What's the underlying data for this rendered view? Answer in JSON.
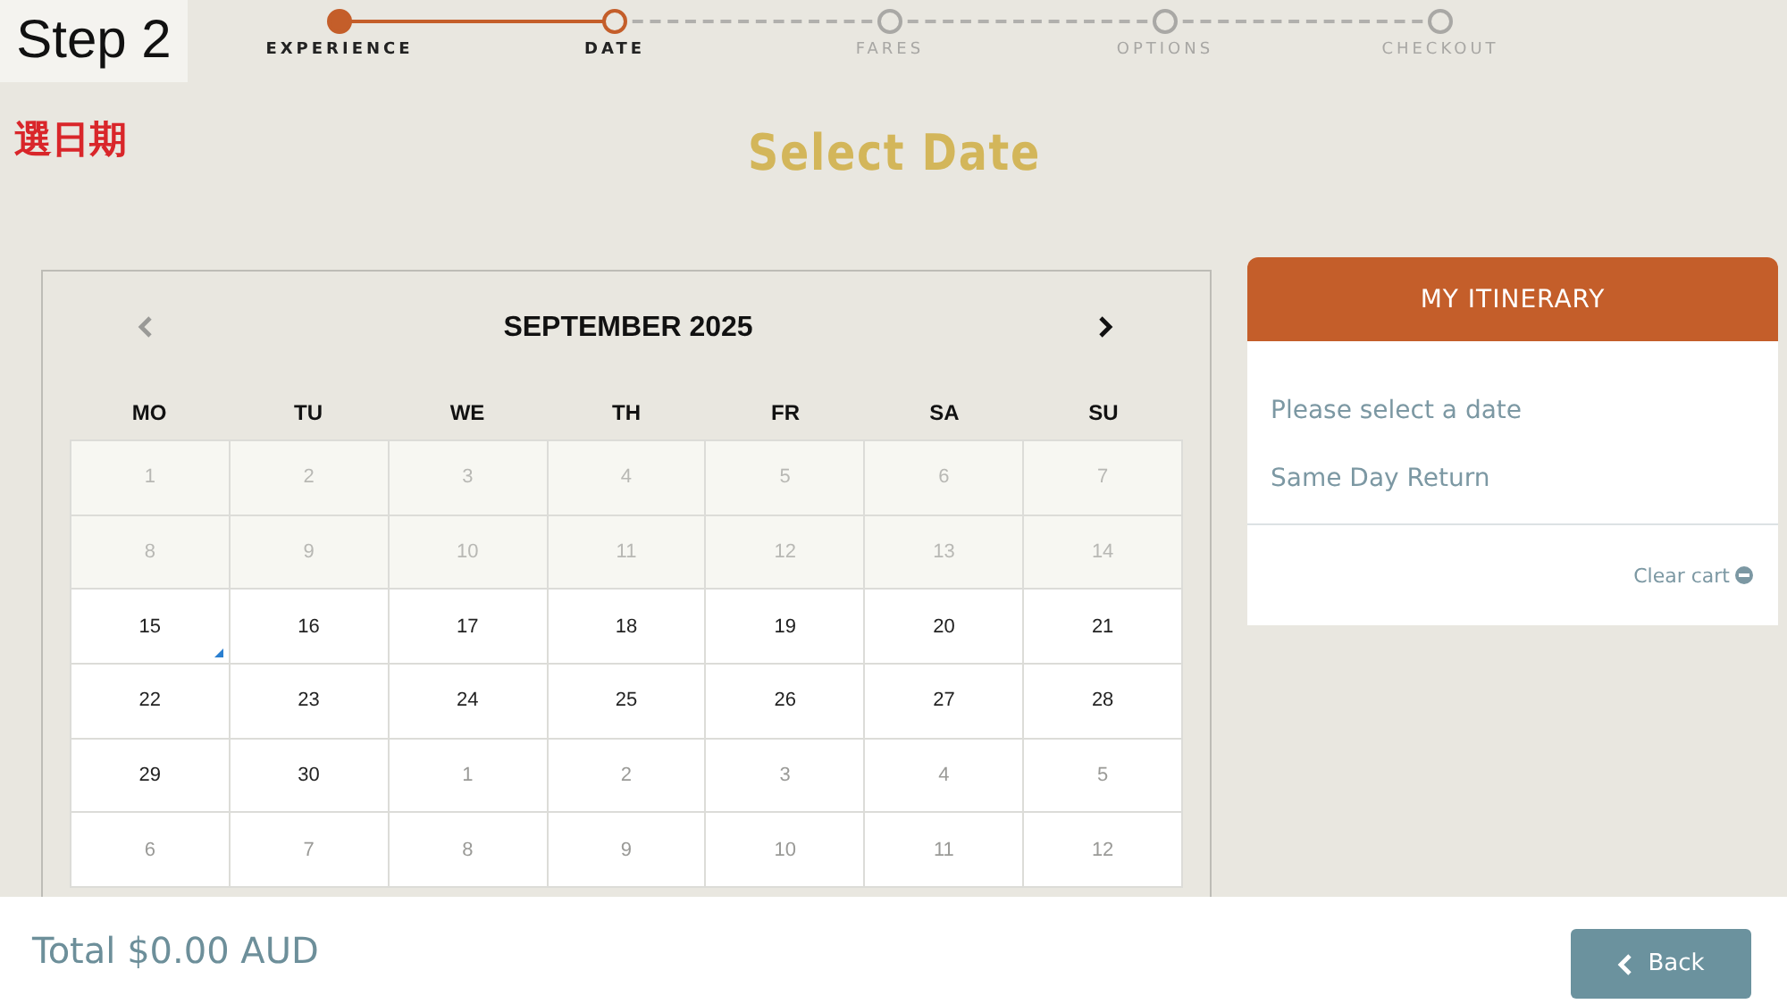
{
  "annotation": {
    "step_label": "Step 2",
    "caption": "選日期"
  },
  "steps": [
    {
      "label": "EXPERIENCE",
      "completed": true,
      "selected": false
    },
    {
      "label": "DATE",
      "completed": false,
      "selected": true
    },
    {
      "label": "FARES",
      "completed": false,
      "selected": false
    },
    {
      "label": "OPTIONS",
      "completed": false,
      "selected": false
    },
    {
      "label": "CHECKOUT",
      "completed": false,
      "selected": false
    }
  ],
  "heading": "Select Date",
  "calendar": {
    "month": "SEPTEMBER 2025",
    "prev": {
      "disabled": true
    },
    "next": {
      "disabled": false
    },
    "weekdays": [
      "MO",
      "TU",
      "WE",
      "TH",
      "FR",
      "SA",
      "SU"
    ],
    "days": [
      {
        "day": "1",
        "kind": "past",
        "today": false
      },
      {
        "day": "2",
        "kind": "past",
        "today": false
      },
      {
        "day": "3",
        "kind": "past",
        "today": false
      },
      {
        "day": "4",
        "kind": "past",
        "today": false
      },
      {
        "day": "5",
        "kind": "past",
        "today": false
      },
      {
        "day": "6",
        "kind": "past",
        "today": false
      },
      {
        "day": "7",
        "kind": "past",
        "today": false
      },
      {
        "day": "8",
        "kind": "past",
        "today": false
      },
      {
        "day": "9",
        "kind": "past",
        "today": false
      },
      {
        "day": "10",
        "kind": "past",
        "today": false
      },
      {
        "day": "11",
        "kind": "past",
        "today": false
      },
      {
        "day": "12",
        "kind": "past",
        "today": false
      },
      {
        "day": "13",
        "kind": "past",
        "today": false
      },
      {
        "day": "14",
        "kind": "past",
        "today": false
      },
      {
        "day": "15",
        "kind": "available",
        "today": true
      },
      {
        "day": "16",
        "kind": "available",
        "today": false
      },
      {
        "day": "17",
        "kind": "available",
        "today": false
      },
      {
        "day": "18",
        "kind": "available",
        "today": false
      },
      {
        "day": "19",
        "kind": "available",
        "today": false
      },
      {
        "day": "20",
        "kind": "available",
        "today": false
      },
      {
        "day": "21",
        "kind": "available",
        "today": false
      },
      {
        "day": "22",
        "kind": "available",
        "today": false
      },
      {
        "day": "23",
        "kind": "available",
        "today": false
      },
      {
        "day": "24",
        "kind": "available",
        "today": false
      },
      {
        "day": "25",
        "kind": "available",
        "today": false
      },
      {
        "day": "26",
        "kind": "available",
        "today": false
      },
      {
        "day": "27",
        "kind": "available",
        "today": false
      },
      {
        "day": "28",
        "kind": "available",
        "today": false
      },
      {
        "day": "29",
        "kind": "available",
        "today": false
      },
      {
        "day": "30",
        "kind": "available",
        "today": false
      },
      {
        "day": "1",
        "kind": "other-month",
        "today": false
      },
      {
        "day": "2",
        "kind": "other-month",
        "today": false
      },
      {
        "day": "3",
        "kind": "other-month",
        "today": false
      },
      {
        "day": "4",
        "kind": "other-month",
        "today": false
      },
      {
        "day": "5",
        "kind": "other-month",
        "today": false
      },
      {
        "day": "6",
        "kind": "other-month",
        "today": false
      },
      {
        "day": "7",
        "kind": "other-month",
        "today": false
      },
      {
        "day": "8",
        "kind": "other-month",
        "today": false
      },
      {
        "day": "9",
        "kind": "other-month",
        "today": false
      },
      {
        "day": "10",
        "kind": "other-month",
        "today": false
      },
      {
        "day": "11",
        "kind": "other-month",
        "today": false
      },
      {
        "day": "12",
        "kind": "other-month",
        "today": false
      }
    ]
  },
  "itinerary": {
    "title": "MY ITINERARY",
    "lines": [
      "Please select a date",
      "Same Day Return"
    ],
    "clear_cart": "Clear cart"
  },
  "footer": {
    "total": "Total $0.00 AUD",
    "back_button": "Back"
  }
}
